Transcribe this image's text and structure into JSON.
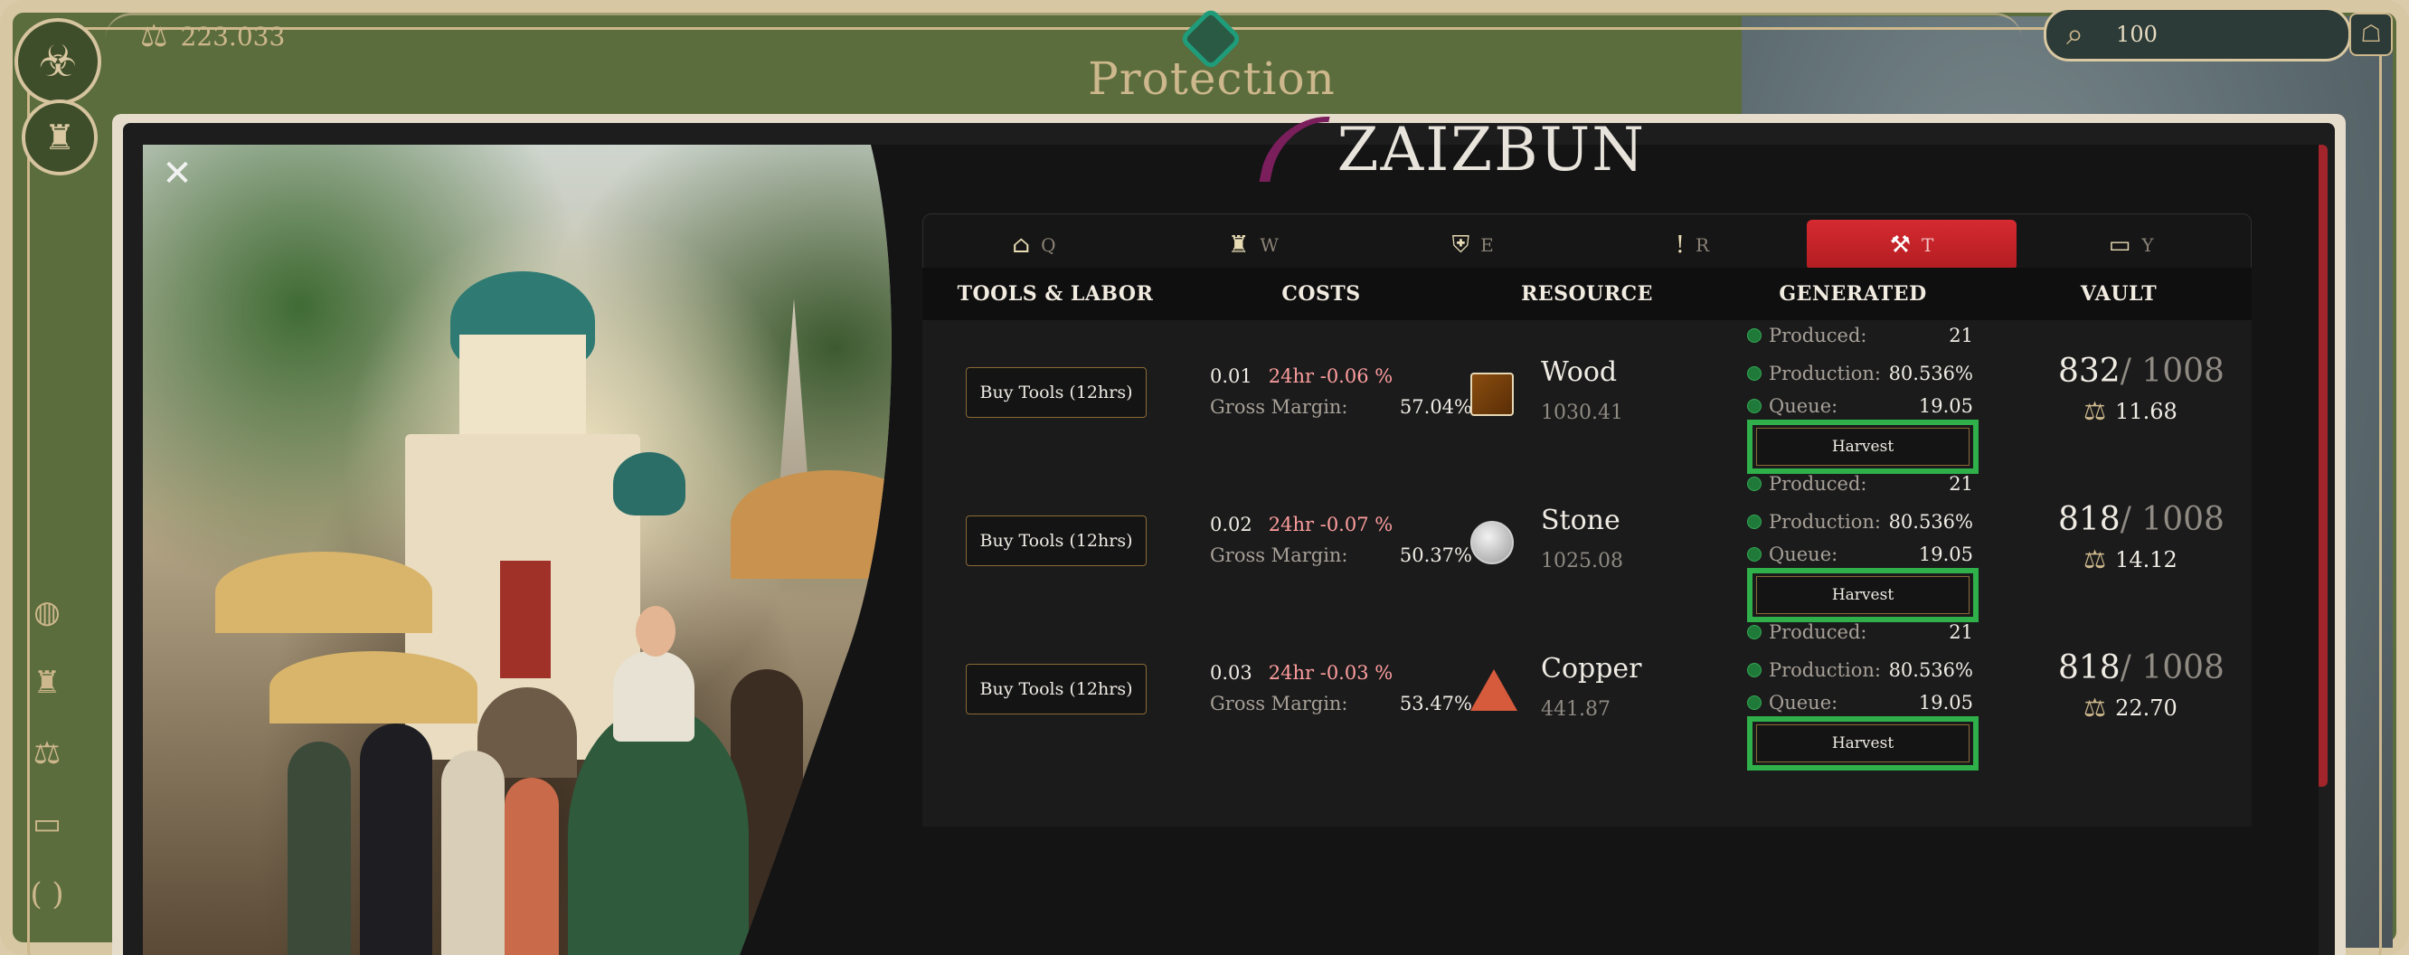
{
  "topbar": {
    "currency_amount": "223.033",
    "page_title": "Protection",
    "search_value": "100"
  },
  "icons": {
    "currency": "balance-scale-icon",
    "search": "magnifier-icon",
    "side_nav": [
      "globe-icon",
      "castle-icon",
      "balance-scale-icon",
      "book-icon",
      "parentheses-icon"
    ]
  },
  "modal": {
    "close_label": "✕",
    "brand_name": "ZAIZBUN",
    "tabs": [
      {
        "key": "Q",
        "icon": "house-icon"
      },
      {
        "key": "W",
        "icon": "castle-icon"
      },
      {
        "key": "E",
        "icon": "shield-icon"
      },
      {
        "key": "R",
        "icon": "sword-icon"
      },
      {
        "key": "T",
        "icon": "pickaxe-icon",
        "active": true
      },
      {
        "key": "Y",
        "icon": "book-icon"
      }
    ],
    "table": {
      "headers": [
        "TOOLS & LABOR",
        "COSTS",
        "RESOURCE",
        "GENERATED",
        "VAULT"
      ],
      "rows": [
        {
          "buy_label": "Buy Tools (12hrs)",
          "cost": "0.01",
          "delta": "24hr -0.06 %",
          "gross_margin_label": "Gross Margin:",
          "gross_margin": "57.04%",
          "resource": "Wood",
          "resource_qty": "1030.41",
          "produced_label": "Produced:",
          "produced": "21",
          "production_label": "Production:",
          "production": "80.536%",
          "queue_label": "Queue:",
          "queue": "19.05",
          "harvest_label": "Harvest",
          "vault_amount": "832",
          "vault_cap": "/ 1008",
          "vault_value": "11.68"
        },
        {
          "buy_label": "Buy Tools (12hrs)",
          "cost": "0.02",
          "delta": "24hr -0.07 %",
          "gross_margin_label": "Gross Margin:",
          "gross_margin": "50.37%",
          "resource": "Stone",
          "resource_qty": "1025.08",
          "produced_label": "Produced:",
          "produced": "21",
          "production_label": "Production:",
          "production": "80.536%",
          "queue_label": "Queue:",
          "queue": "19.05",
          "harvest_label": "Harvest",
          "vault_amount": "818",
          "vault_cap": "/ 1008",
          "vault_value": "14.12"
        },
        {
          "buy_label": "Buy Tools (12hrs)",
          "cost": "0.03",
          "delta": "24hr -0.03 %",
          "gross_margin_label": "Gross Margin:",
          "gross_margin": "53.47%",
          "resource": "Copper",
          "resource_qty": "441.87",
          "produced_label": "Produced:",
          "produced": "21",
          "production_label": "Production:",
          "production": "80.536%",
          "queue_label": "Queue:",
          "queue": "19.05",
          "harvest_label": "Harvest",
          "vault_amount": "818",
          "vault_cap": "/ 1008",
          "vault_value": "22.70"
        }
      ]
    }
  },
  "colors": {
    "frame_green": "#5b6d3d",
    "frame_beige": "#d8c7a3",
    "active_tab": "#c9252b",
    "harvest_highlight": "#2fb04a",
    "delta_text": "#ff9e9e"
  }
}
